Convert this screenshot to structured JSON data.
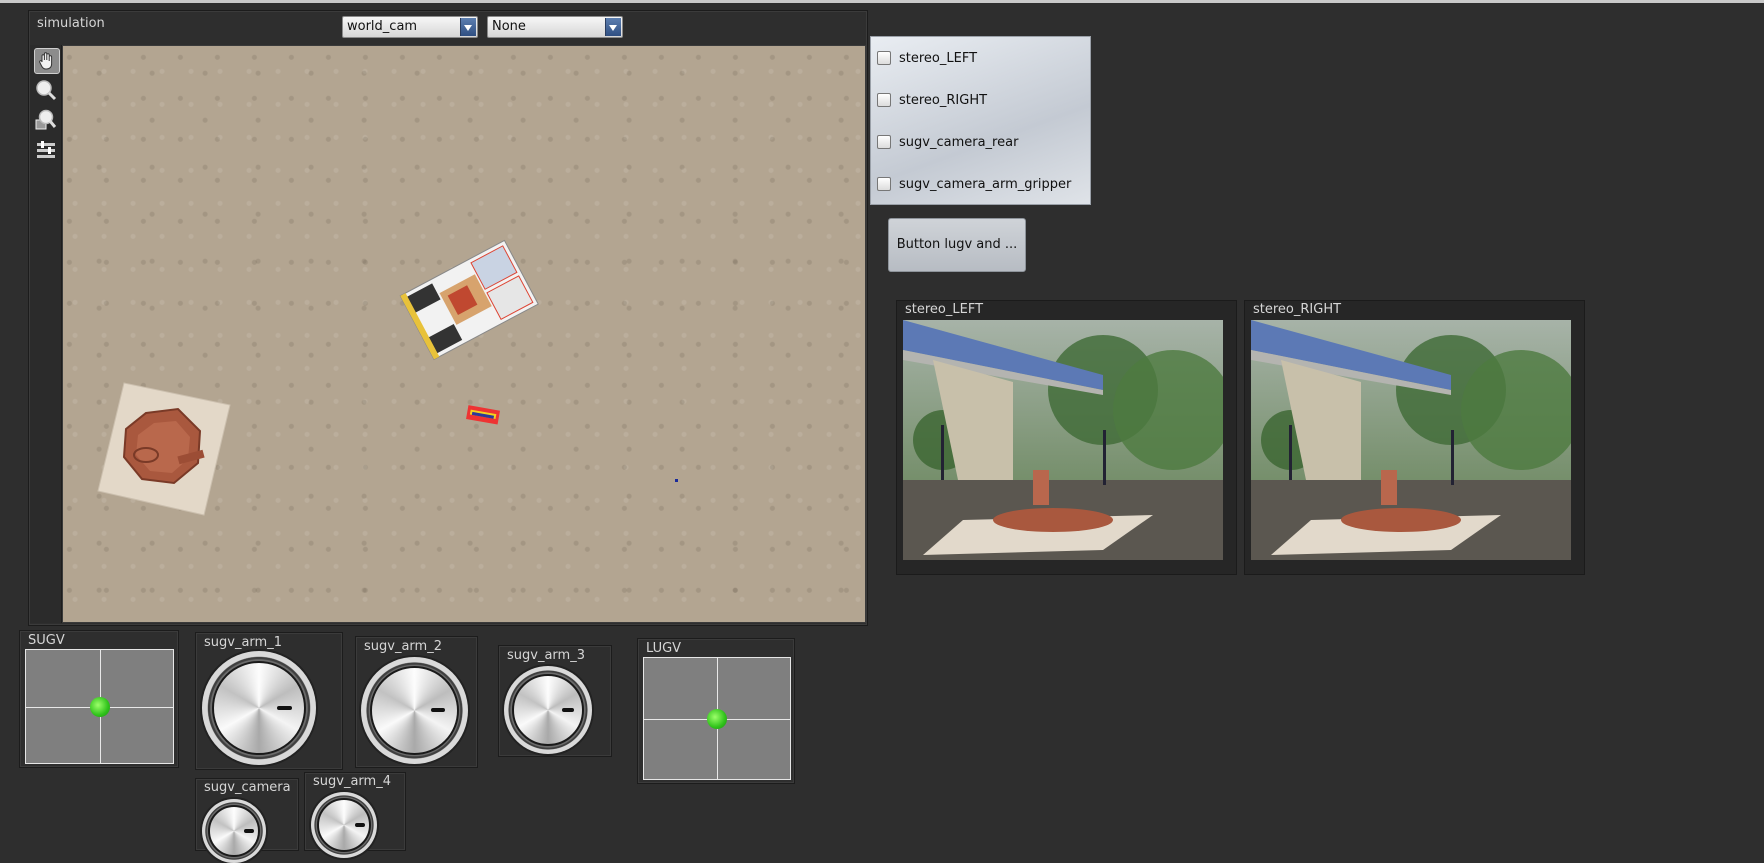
{
  "simulation": {
    "title": "simulation",
    "camera_select": "world_cam",
    "overlay_select": "None",
    "tools": [
      "hand-icon",
      "zoom-icon",
      "zoom-region-icon",
      "settings-icon"
    ]
  },
  "cameras_panel": {
    "items": [
      {
        "label": "stereo_LEFT",
        "checked": false
      },
      {
        "label": "stereo_RIGHT",
        "checked": false
      },
      {
        "label": "sugv_camera_rear",
        "checked": false
      },
      {
        "label": "sugv_camera_arm_gripper",
        "checked": false
      }
    ]
  },
  "action_button": {
    "label": "Button lugv and ..."
  },
  "feeds": {
    "left": {
      "title": "stereo_LEFT"
    },
    "right": {
      "title": "stereo_RIGHT"
    }
  },
  "controls": {
    "sugv": {
      "title": "SUGV"
    },
    "lugv": {
      "title": "LUGV"
    },
    "arm1": {
      "title": "sugv_arm_1"
    },
    "arm2": {
      "title": "sugv_arm_2"
    },
    "arm3": {
      "title": "sugv_arm_3"
    },
    "camera": {
      "title": "sugv_camera"
    },
    "arm4": {
      "title": "sugv_arm_4"
    }
  },
  "colors": {
    "background": "#2e2e2e",
    "joystick_dot": "#2fc21a",
    "accent": "#2f4f82"
  }
}
